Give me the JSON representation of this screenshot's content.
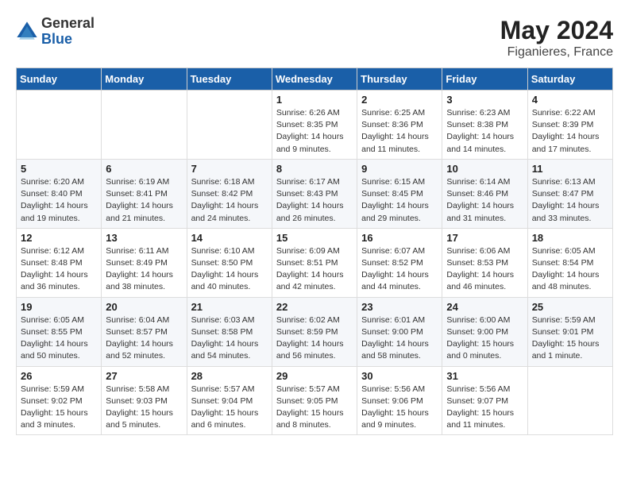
{
  "header": {
    "logo_general": "General",
    "logo_blue": "Blue",
    "month_title": "May 2024",
    "location": "Figanieres, France"
  },
  "weekdays": [
    "Sunday",
    "Monday",
    "Tuesday",
    "Wednesday",
    "Thursday",
    "Friday",
    "Saturday"
  ],
  "weeks": [
    [
      {
        "day": "",
        "info": ""
      },
      {
        "day": "",
        "info": ""
      },
      {
        "day": "",
        "info": ""
      },
      {
        "day": "1",
        "info": "Sunrise: 6:26 AM\nSunset: 8:35 PM\nDaylight: 14 hours\nand 9 minutes."
      },
      {
        "day": "2",
        "info": "Sunrise: 6:25 AM\nSunset: 8:36 PM\nDaylight: 14 hours\nand 11 minutes."
      },
      {
        "day": "3",
        "info": "Sunrise: 6:23 AM\nSunset: 8:38 PM\nDaylight: 14 hours\nand 14 minutes."
      },
      {
        "day": "4",
        "info": "Sunrise: 6:22 AM\nSunset: 8:39 PM\nDaylight: 14 hours\nand 17 minutes."
      }
    ],
    [
      {
        "day": "5",
        "info": "Sunrise: 6:20 AM\nSunset: 8:40 PM\nDaylight: 14 hours\nand 19 minutes."
      },
      {
        "day": "6",
        "info": "Sunrise: 6:19 AM\nSunset: 8:41 PM\nDaylight: 14 hours\nand 21 minutes."
      },
      {
        "day": "7",
        "info": "Sunrise: 6:18 AM\nSunset: 8:42 PM\nDaylight: 14 hours\nand 24 minutes."
      },
      {
        "day": "8",
        "info": "Sunrise: 6:17 AM\nSunset: 8:43 PM\nDaylight: 14 hours\nand 26 minutes."
      },
      {
        "day": "9",
        "info": "Sunrise: 6:15 AM\nSunset: 8:45 PM\nDaylight: 14 hours\nand 29 minutes."
      },
      {
        "day": "10",
        "info": "Sunrise: 6:14 AM\nSunset: 8:46 PM\nDaylight: 14 hours\nand 31 minutes."
      },
      {
        "day": "11",
        "info": "Sunrise: 6:13 AM\nSunset: 8:47 PM\nDaylight: 14 hours\nand 33 minutes."
      }
    ],
    [
      {
        "day": "12",
        "info": "Sunrise: 6:12 AM\nSunset: 8:48 PM\nDaylight: 14 hours\nand 36 minutes."
      },
      {
        "day": "13",
        "info": "Sunrise: 6:11 AM\nSunset: 8:49 PM\nDaylight: 14 hours\nand 38 minutes."
      },
      {
        "day": "14",
        "info": "Sunrise: 6:10 AM\nSunset: 8:50 PM\nDaylight: 14 hours\nand 40 minutes."
      },
      {
        "day": "15",
        "info": "Sunrise: 6:09 AM\nSunset: 8:51 PM\nDaylight: 14 hours\nand 42 minutes."
      },
      {
        "day": "16",
        "info": "Sunrise: 6:07 AM\nSunset: 8:52 PM\nDaylight: 14 hours\nand 44 minutes."
      },
      {
        "day": "17",
        "info": "Sunrise: 6:06 AM\nSunset: 8:53 PM\nDaylight: 14 hours\nand 46 minutes."
      },
      {
        "day": "18",
        "info": "Sunrise: 6:05 AM\nSunset: 8:54 PM\nDaylight: 14 hours\nand 48 minutes."
      }
    ],
    [
      {
        "day": "19",
        "info": "Sunrise: 6:05 AM\nSunset: 8:55 PM\nDaylight: 14 hours\nand 50 minutes."
      },
      {
        "day": "20",
        "info": "Sunrise: 6:04 AM\nSunset: 8:57 PM\nDaylight: 14 hours\nand 52 minutes."
      },
      {
        "day": "21",
        "info": "Sunrise: 6:03 AM\nSunset: 8:58 PM\nDaylight: 14 hours\nand 54 minutes."
      },
      {
        "day": "22",
        "info": "Sunrise: 6:02 AM\nSunset: 8:59 PM\nDaylight: 14 hours\nand 56 minutes."
      },
      {
        "day": "23",
        "info": "Sunrise: 6:01 AM\nSunset: 9:00 PM\nDaylight: 14 hours\nand 58 minutes."
      },
      {
        "day": "24",
        "info": "Sunrise: 6:00 AM\nSunset: 9:00 PM\nDaylight: 15 hours\nand 0 minutes."
      },
      {
        "day": "25",
        "info": "Sunrise: 5:59 AM\nSunset: 9:01 PM\nDaylight: 15 hours\nand 1 minute."
      }
    ],
    [
      {
        "day": "26",
        "info": "Sunrise: 5:59 AM\nSunset: 9:02 PM\nDaylight: 15 hours\nand 3 minutes."
      },
      {
        "day": "27",
        "info": "Sunrise: 5:58 AM\nSunset: 9:03 PM\nDaylight: 15 hours\nand 5 minutes."
      },
      {
        "day": "28",
        "info": "Sunrise: 5:57 AM\nSunset: 9:04 PM\nDaylight: 15 hours\nand 6 minutes."
      },
      {
        "day": "29",
        "info": "Sunrise: 5:57 AM\nSunset: 9:05 PM\nDaylight: 15 hours\nand 8 minutes."
      },
      {
        "day": "30",
        "info": "Sunrise: 5:56 AM\nSunset: 9:06 PM\nDaylight: 15 hours\nand 9 minutes."
      },
      {
        "day": "31",
        "info": "Sunrise: 5:56 AM\nSunset: 9:07 PM\nDaylight: 15 hours\nand 11 minutes."
      },
      {
        "day": "",
        "info": ""
      }
    ]
  ]
}
